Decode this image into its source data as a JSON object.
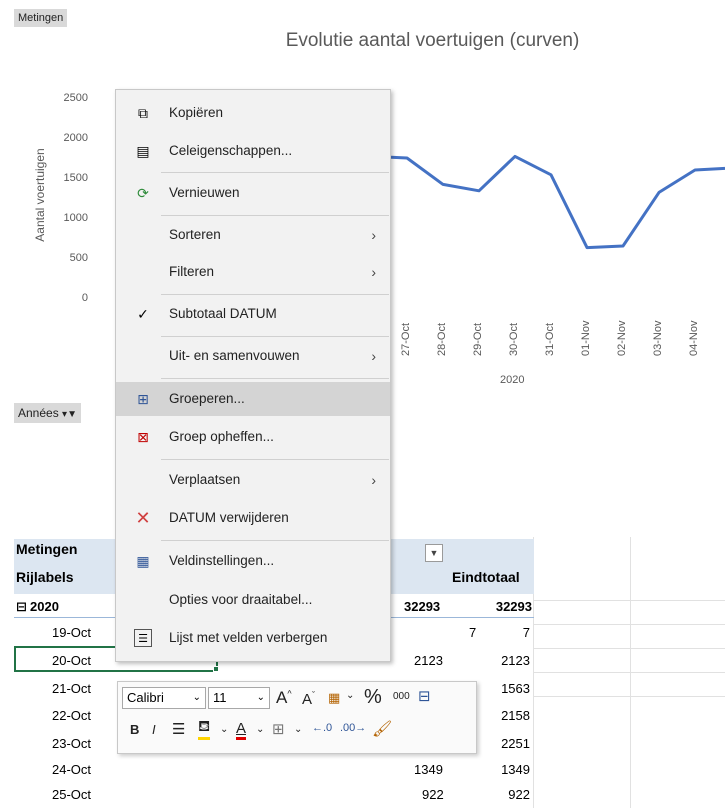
{
  "field_button": "Metingen",
  "chart": {
    "title": "Evolutie aantal voertuigen (curven)",
    "ylabel": "Aantal voertuigen",
    "yticks": [
      "2500",
      "2000",
      "1500",
      "1000",
      "500",
      "0"
    ],
    "group_label": "2020",
    "line_color": "#4472c4"
  },
  "chart_data": {
    "type": "line",
    "title": "Evolutie aantal voertuigen (curven)",
    "ylabel": "Aantal voertuigen",
    "ylim": [
      0,
      2500
    ],
    "x": [
      "27-Oct",
      "28-Oct",
      "29-Oct",
      "30-Oct",
      "31-Oct",
      "01-Nov",
      "02-Nov",
      "03-Nov",
      "04-Nov"
    ],
    "x_group": "2020",
    "y_visible_from_partial": 1760,
    "values": [
      1750,
      1420,
      1340,
      1770,
      1540,
      630,
      650,
      1320,
      1600
    ],
    "y_end": 1620
  },
  "filter_field": "Années",
  "pivot": {
    "header1": "Metingen",
    "header2": "Rijlabels",
    "col_total": "Eindtotaal",
    "group": "2020",
    "group_value": "32293",
    "group_total": "32293",
    "rows": [
      {
        "label": "19-Oct",
        "value": "7",
        "total": "7"
      },
      {
        "label": "20-Oct",
        "value": "2123",
        "total": "2123"
      },
      {
        "label": "21-Oct",
        "value": "",
        "total": "1563"
      },
      {
        "label": "22-Oct",
        "value": "",
        "total": "2158"
      },
      {
        "label": "23-Oct",
        "value": "",
        "total": "2251"
      },
      {
        "label": "24-Oct",
        "value": "1349",
        "total": "1349"
      },
      {
        "label": "25-Oct",
        "value": "922",
        "total": "922"
      }
    ]
  },
  "menu": {
    "copy": "Kopiëren",
    "cell_props": "Celeigenschappen...",
    "refresh": "Vernieuwen",
    "sort": "Sorteren",
    "filter": "Filteren",
    "subtotal": "Subtotaal DATUM",
    "expand": "Uit- en samenvouwen",
    "group": "Groeperen...",
    "ungroup": "Groep opheffen...",
    "move": "Verplaatsen",
    "remove": "DATUM verwijderen",
    "field_settings": "Veldinstellingen...",
    "pivot_options": "Opties voor draaitabel...",
    "hide_fields": "Lijst met velden verbergen"
  },
  "mini_toolbar": {
    "font_name": "Calibri",
    "font_size": "11",
    "bold": "B",
    "italic": "I",
    "percent": "%",
    "thousands": "000"
  }
}
